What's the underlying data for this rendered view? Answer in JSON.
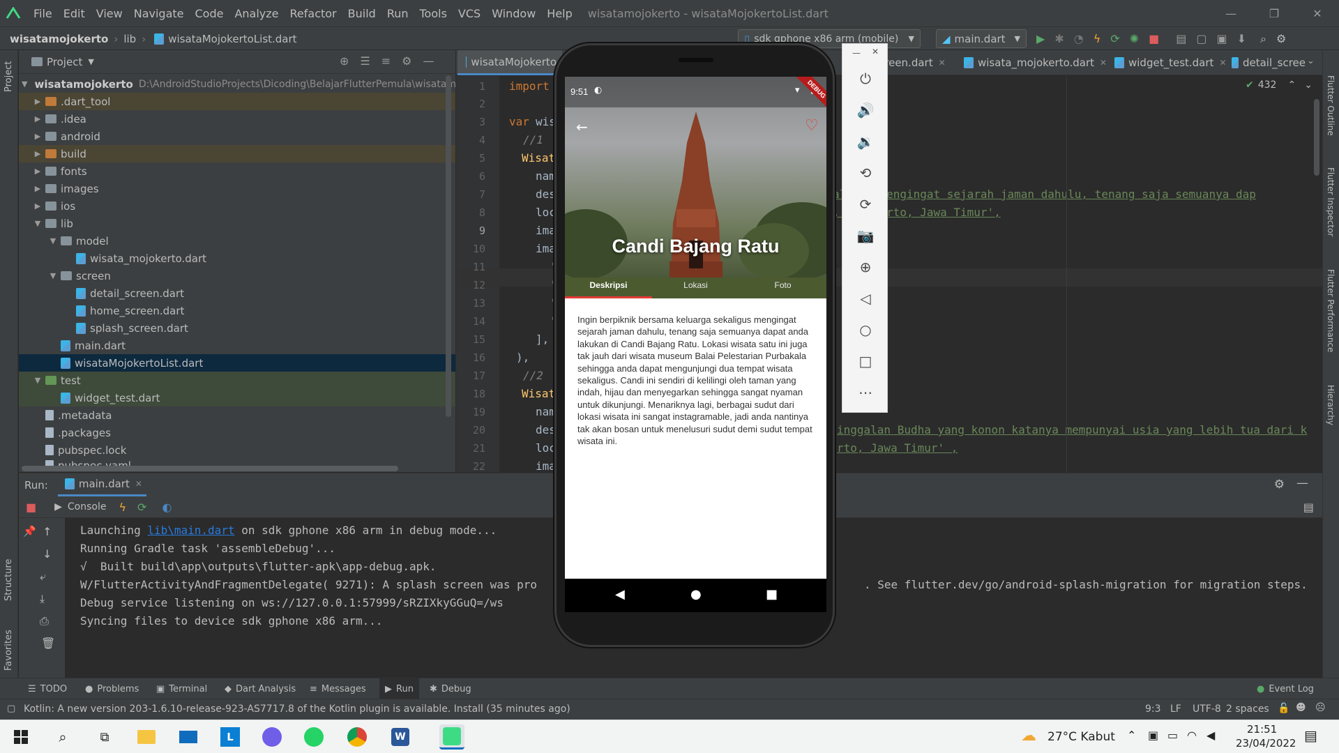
{
  "window": {
    "menu": [
      "File",
      "Edit",
      "View",
      "Navigate",
      "Code",
      "Analyze",
      "Refactor",
      "Build",
      "Run",
      "Tools",
      "VCS",
      "Window",
      "Help"
    ],
    "title": "wisatamojokerto - wisataMojokertoList.dart"
  },
  "nav": {
    "crumbs": [
      "wisatamojokerto",
      "lib",
      "wisataMojokertoList.dart"
    ],
    "device": "sdk gphone x86 arm (mobile)",
    "run_config": "main.dart"
  },
  "left_strip": {
    "project": "Project",
    "structure": "Structure",
    "favorites": "Favorites"
  },
  "right_strip": {
    "outline": "Flutter Outline",
    "inspector": "Flutter Inspector",
    "performance": "Flutter Performance",
    "hierarchy": "Hierarchy"
  },
  "project": {
    "header": "Project",
    "root_name": "wisatamojokerto",
    "root_path": "D:\\AndroidStudioProjects\\Dicoding\\BelajarFlutterPemula\\wisatam",
    "items": [
      {
        "label": ".dart_tool"
      },
      {
        "label": ".idea"
      },
      {
        "label": "android"
      },
      {
        "label": "build"
      },
      {
        "label": "fonts"
      },
      {
        "label": "images"
      },
      {
        "label": "ios"
      },
      {
        "label": "lib"
      },
      {
        "label": "model"
      },
      {
        "label": "wisata_mojokerto.dart"
      },
      {
        "label": "screen"
      },
      {
        "label": "detail_screen.dart"
      },
      {
        "label": "home_screen.dart"
      },
      {
        "label": "splash_screen.dart"
      },
      {
        "label": "main.dart"
      },
      {
        "label": "wisataMojokertoList.dart"
      },
      {
        "label": "test"
      },
      {
        "label": "widget_test.dart"
      },
      {
        "label": ".metadata"
      },
      {
        "label": ".packages"
      },
      {
        "label": "pubspec.lock"
      },
      {
        "label": "pubspec.yaml"
      }
    ]
  },
  "editor": {
    "tabs": [
      "wisataMojokerto",
      "creen.dart",
      "wisata_mojokerto.dart",
      "widget_test.dart",
      "detail_scree"
    ],
    "warnings": "432",
    "line_numbers": [
      "1",
      "2",
      "3",
      "4",
      "5",
      "6",
      "7",
      "8",
      "9",
      "10",
      "11",
      "12",
      "13",
      "14",
      "15",
      "16",
      "17",
      "18",
      "19",
      "20",
      "21",
      "22"
    ],
    "code": {
      "l1": "import",
      "l3a": "var",
      "l3b": "wis",
      "l4": "//1",
      "l5": "Wisat",
      "l6": "nam",
      "l7": "des",
      "l8": "loc",
      "l9": "ima",
      "l10": "ima",
      "l11": "'",
      "l12": "'",
      "l13": "'",
      "l14": "'",
      "l15": "],",
      "l16": "),",
      "l17": "//2",
      "l18": "Wisat",
      "l19": "nam",
      "l20": "des",
      "l21": "loc",
      "l22": "ima",
      "r7": "aligus mengingat sejarah jaman dahulu, tenang saja semuanya dap",
      "r8": ", Mojokerto, Jawa Timur',",
      "r20": "inggalan Budha yang konon katanya mempunyai usia yang lebih tua dari k",
      "r21": "rto, Jawa Timur' ,"
    }
  },
  "run": {
    "label": "Run:",
    "tab": "main.dart",
    "console_label": "Console",
    "lines": [
      "Launching ",
      "lib\\main.dart",
      " on sdk gphone x86 arm in debug mode...",
      "Running Gradle task 'assembleDebug'...",
      "√  Built build\\app\\outputs\\flutter-apk\\app-debug.apk.",
      "W/FlutterActivityAndFragmentDelegate( 9271): A splash screen was pro",
      ". See flutter.dev/go/android-splash-migration for migration steps.",
      "Debug service listening on ws://127.0.0.1:57999/sRZIXkyGGuQ=/ws",
      "Syncing files to device sdk gphone x86 arm..."
    ]
  },
  "toolwindows": [
    "TODO",
    "Problems",
    "Terminal",
    "Dart Analysis",
    "Messages",
    "Run",
    "Debug"
  ],
  "event_log": "Event Log",
  "status": {
    "message": "Kotlin: A new version 203-1.6.10-release-923-AS7717.8 of the Kotlin plugin is available. Install (35 minutes ago)",
    "position": "9:3",
    "line_sep": "LF",
    "encoding": "UTF-8",
    "indent": "2 spaces"
  },
  "phone": {
    "time": "9:51",
    "debug_ribbon": "DEBUG",
    "title": "Candi Bajang Ratu",
    "tabs": [
      "Deskripsi",
      "Lokasi",
      "Foto"
    ],
    "description": "Ingin berpiknik bersama keluarga sekaligus mengingat sejarah jaman dahulu, tenang saja semuanya dapat anda lakukan di Candi Bajang Ratu. Lokasi wisata satu ini juga tak jauh dari wisata museum Balai Pelestarian Purbakala sehingga anda dapat mengunjungi dua tempat wisata sekaligus. Candi ini sendiri di kelilingi oleh taman yang indah, hijau dan menyegarkan sehingga sangat nyaman untuk dikunjungi. Menariknya lagi, berbagai sudut dari lokasi wisata ini sangat instagramable, jadi anda nantinya tak akan bosan untuk menelusuri sudut demi sudut tempat wisata ini."
  },
  "taskbar": {
    "weather": "27°C  Kabut",
    "time": "21:51",
    "date": "23/04/2022"
  },
  "colors": {
    "accent": "#4a88c7",
    "brand_red": "#e53935",
    "ide_bg": "#2b2b2b",
    "panel_bg": "#3c3f41"
  }
}
